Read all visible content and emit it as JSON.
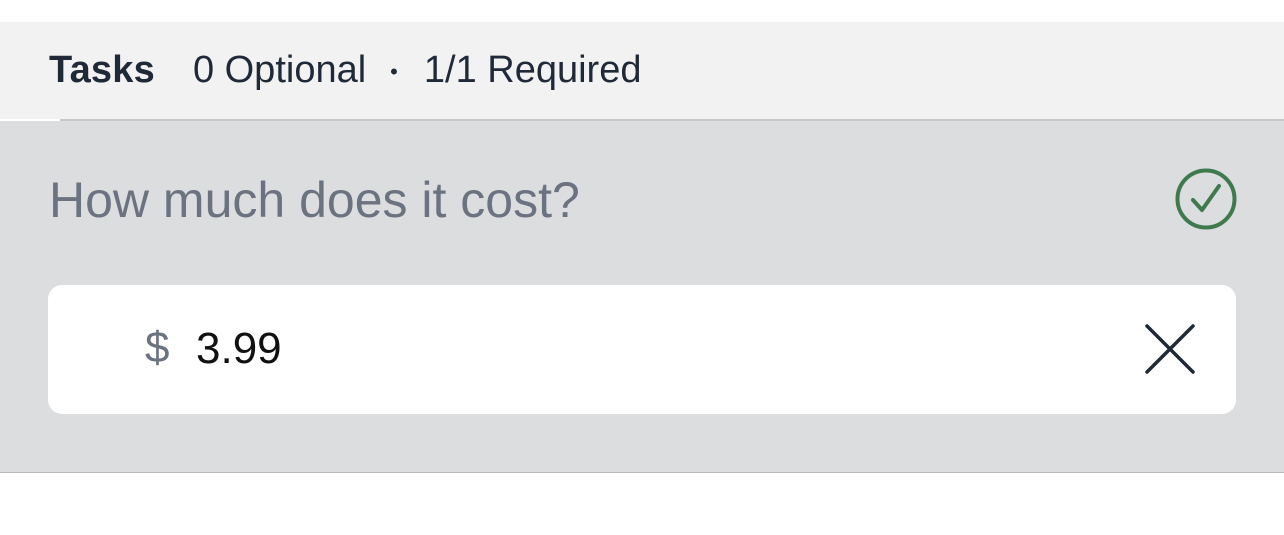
{
  "tasks_header": {
    "title": "Tasks",
    "optional_count": "0 Optional",
    "separator": "•",
    "required_count": "1/1 Required"
  },
  "task": {
    "question": "How much does it cost?",
    "status_icon": "check-circle-icon",
    "status_color": "#3f7a4f",
    "currency_symbol": "$",
    "answer_value": "3.99",
    "clear_icon": "close-icon"
  }
}
